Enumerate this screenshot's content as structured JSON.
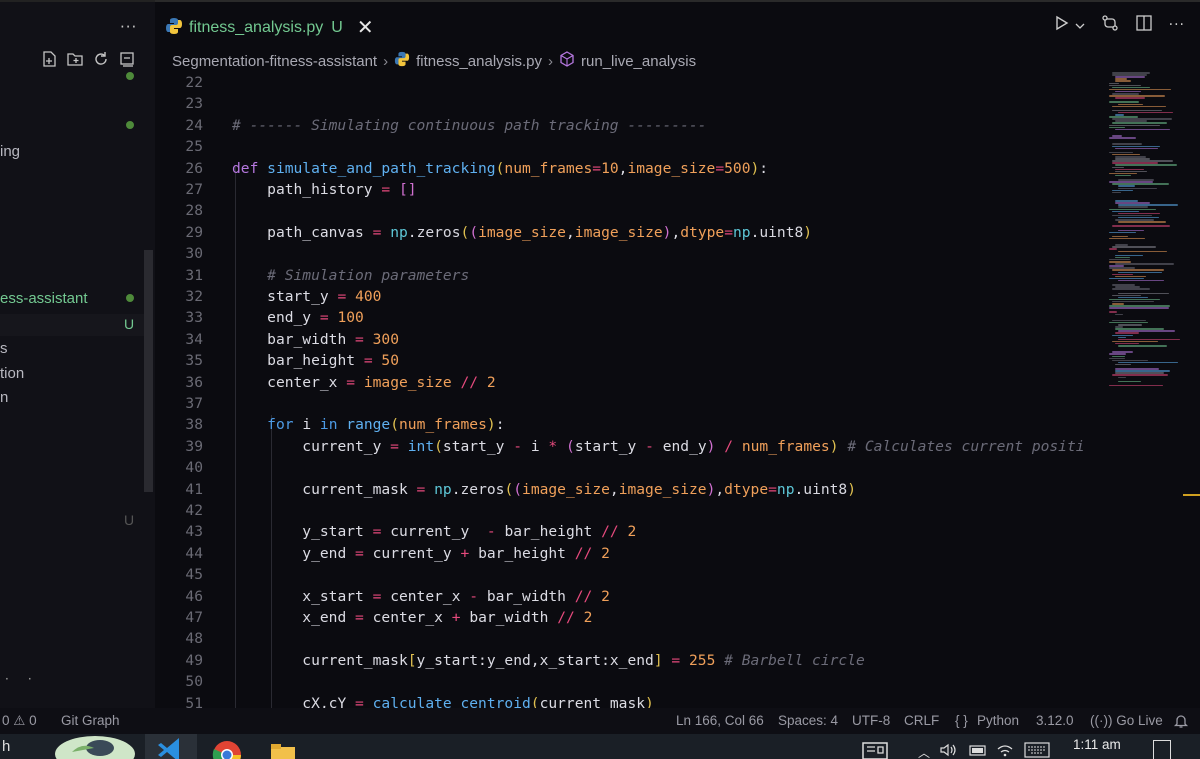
{
  "sidebar": {
    "more": "···",
    "items": [
      {
        "label": "ing",
        "git": false
      },
      {
        "label": "ess-assistant",
        "git": true
      },
      {
        "label": "s",
        "git": false
      },
      {
        "label": "tion",
        "git": false
      },
      {
        "label": "n",
        "git": false
      }
    ],
    "untracked_badge": "U",
    "bottom_badge": "U"
  },
  "tab": {
    "filename": "fitness_analysis.py",
    "status": "U",
    "close": "✕"
  },
  "breadcrumb": {
    "folder": "Segmentation-fitness-assistant",
    "file": "fitness_analysis.py",
    "symbol": "run_live_analysis"
  },
  "editor": {
    "lines": [
      {
        "n": "22"
      },
      {
        "n": "23"
      },
      {
        "n": "24"
      },
      {
        "n": "25"
      },
      {
        "n": "26"
      },
      {
        "n": "27"
      },
      {
        "n": "28"
      },
      {
        "n": "29"
      },
      {
        "n": "30"
      },
      {
        "n": "31"
      },
      {
        "n": "32"
      },
      {
        "n": "33"
      },
      {
        "n": "34"
      },
      {
        "n": "35"
      },
      {
        "n": "36"
      },
      {
        "n": "37"
      },
      {
        "n": "38"
      },
      {
        "n": "39"
      },
      {
        "n": "40"
      },
      {
        "n": "41"
      },
      {
        "n": "42"
      },
      {
        "n": "43"
      },
      {
        "n": "44"
      },
      {
        "n": "45"
      },
      {
        "n": "46"
      },
      {
        "n": "47"
      },
      {
        "n": "48"
      },
      {
        "n": "49"
      },
      {
        "n": "50"
      },
      {
        "n": "51"
      }
    ],
    "code": {
      "l23": "# ------ Simulating continuous path tracking ---------",
      "l25_def": "def",
      "l25_fn": "simulate_and_path_tracking",
      "l25_p1": "num_frames",
      "l25_v1": "10",
      "l25_p2": "image_size",
      "l25_v2": "500",
      "l26": "path_history",
      "l28_var": "path_canvas",
      "l28_np": "np",
      "l28_zeros": "zeros",
      "l28_arg1": "image_size",
      "l28_arg2": "image_size",
      "l28_dtype": "dtype",
      "l28_np2": "np",
      "l28_uint8": "uint8",
      "l30": "# Simulation parameters",
      "l31_var": "start_y",
      "l31_val": "400",
      "l32_var": "end_y",
      "l32_val": "100",
      "l33_var": "bar_width",
      "l33_val": "300",
      "l34_var": "bar_height",
      "l34_val": "50",
      "l35_var": "center_x",
      "l35_rhs": "image_size",
      "l35_val": "2",
      "l37_for": "for",
      "l37_i": "i",
      "l37_in": "in",
      "l37_range": "range",
      "l37_arg": "num_frames",
      "l38_var": "current_y",
      "l38_int": "int",
      "l38_a": "start_y",
      "l38_i": "i",
      "l38_b": "start_y",
      "l38_c": "end_y",
      "l38_d": "num_frames",
      "l38_cmt": "# Calculates current positi",
      "l40_var": "current_mask",
      "l40_np": "np",
      "l40_zeros": "zeros",
      "l40_a1": "image_size",
      "l40_a2": "image_size",
      "l40_dtype": "dtype",
      "l40_np2": "np",
      "l40_uint8": "uint8",
      "l42_var": "y_start",
      "l42_a": "current_y",
      "l42_b": "bar_height",
      "l42_v": "2",
      "l43_var": "y_end",
      "l43_a": "current_y",
      "l43_b": "bar_height",
      "l43_v": "2",
      "l45_var": "x_start",
      "l45_a": "center_x",
      "l45_b": "bar_width",
      "l45_v": "2",
      "l46_var": "x_end",
      "l46_a": "center_x",
      "l46_b": "bar_width",
      "l46_v": "2",
      "l48_var": "current_mask",
      "l48_a": "y_start",
      "l48_b": "y_end",
      "l48_c": "x_start",
      "l48_d": "x_end",
      "l48_v": "255",
      "l48_cmt": "# Barbell circle",
      "l50_var": "cX,cY",
      "l50_fn": "calculate_centroid",
      "l50_arg": "current_mask"
    }
  },
  "statusbar": {
    "problems": "0",
    "warnings": "0",
    "git_graph": "Git Graph",
    "position": "Ln 166, Col 66",
    "spaces": "Spaces: 4",
    "encoding": "UTF-8",
    "eol": "CRLF",
    "language_braces": "{ }",
    "language": "Python",
    "version": "3.12.0",
    "golive": "Go Live"
  },
  "taskbar": {
    "left_text": "h",
    "time": "1:11 am"
  },
  "colors": {
    "accent_git": "#73c991",
    "keyword": "#b678e0",
    "number": "#f0a05a",
    "operator": "#e64a7d",
    "function": "#5fb0f0"
  }
}
